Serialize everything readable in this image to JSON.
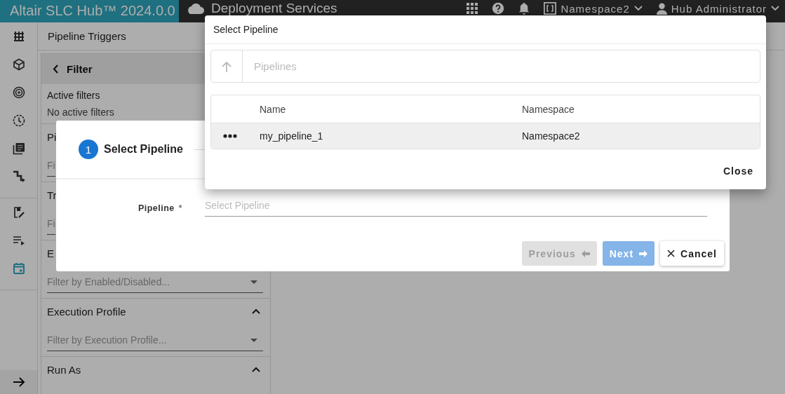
{
  "top_bar": {
    "brand": "Altair SLC Hub™ 2024.0.0",
    "app_title": "Deployment Services",
    "namespace": "Namespace2",
    "user": "Hub Administrator"
  },
  "nav_rail": {
    "groups": [
      [
        {
          "kind": "shelves",
          "selected": false
        },
        {
          "kind": "cube",
          "selected": false
        },
        {
          "kind": "target",
          "selected": false
        },
        {
          "kind": "history",
          "selected": false
        },
        {
          "kind": "library",
          "selected": false
        },
        {
          "kind": "steps",
          "selected": false
        }
      ],
      [
        {
          "kind": "edit-note",
          "selected": false
        },
        {
          "kind": "playlist",
          "selected": false
        },
        {
          "kind": "calendar",
          "selected": true
        }
      ]
    ]
  },
  "page": {
    "title": "Pipeline Triggers"
  },
  "filter_panel": {
    "title": "Filter",
    "active_filters_label": "Active filters",
    "active_filters_value": "No active filters",
    "sections": [
      {
        "title": "Pi",
        "placeholder": "Fi",
        "kind": "text"
      },
      {
        "title": "Tr",
        "placeholder": "Fi",
        "kind": "text"
      },
      {
        "title": "E",
        "placeholder": "Filter by Enabled/Disabled...",
        "kind": "select"
      },
      {
        "title": "Execution Profile",
        "placeholder": "Filter by Execution Profile...",
        "kind": "select",
        "expanded": true
      },
      {
        "title": "Run As",
        "kind": "header",
        "expanded": true
      }
    ]
  },
  "wizard": {
    "steps": [
      {
        "number": "1",
        "label": "Select Pipeline",
        "selected": true
      }
    ],
    "field": {
      "label": "Pipeline",
      "required_mark": "*",
      "placeholder": "Select Pipeline"
    },
    "buttons": [
      {
        "label": "Previous",
        "kind": "previous",
        "disabled": true
      },
      {
        "label": "Next",
        "kind": "next",
        "disabled": true
      },
      {
        "label": "Cancel",
        "kind": "cancel",
        "disabled": false
      }
    ]
  },
  "picker": {
    "title": "Select Pipeline",
    "search": {
      "placeholder": "Pipelines"
    },
    "table": {
      "columns": [
        "Name",
        "Namespace"
      ],
      "rows": [
        {
          "name": "my_pipeline_1",
          "namespace": "Namespace2",
          "hovered": true
        }
      ]
    },
    "buttons": [
      "Close"
    ]
  }
}
